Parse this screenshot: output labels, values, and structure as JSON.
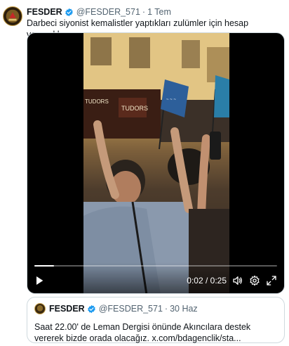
{
  "tweet": {
    "author_name": "FESDER",
    "author_handle": "@FESDER_571",
    "separator": "·",
    "time": "1 Tem",
    "text": "Darbeci siyonist kemalistler yaptıkları zulümler için hesap verecekler"
  },
  "video": {
    "timecode": "0:02 / 0:25",
    "progress_fraction": 0.08,
    "shop_sign_1": "TUDORS",
    "shop_sign_2": "TUDORS"
  },
  "quote": {
    "author_name": "FESDER",
    "author_handle": "@FESDER_571",
    "separator": "·",
    "time": "30 Haz",
    "text": "Saat 22.00' de Leman Dergisi önünde Akıncılara destek vererek bizde orada olacağız. x.com/bdagenclik/sta..."
  },
  "colors": {
    "verified_blue": "#1d9bf0",
    "secondary_text": "#536471",
    "border": "#cfd9de"
  },
  "icons": {
    "verified": "verified-badge-icon",
    "play": "play-icon",
    "volume": "volume-icon",
    "settings": "gear-icon",
    "fullscreen": "fullscreen-icon"
  }
}
